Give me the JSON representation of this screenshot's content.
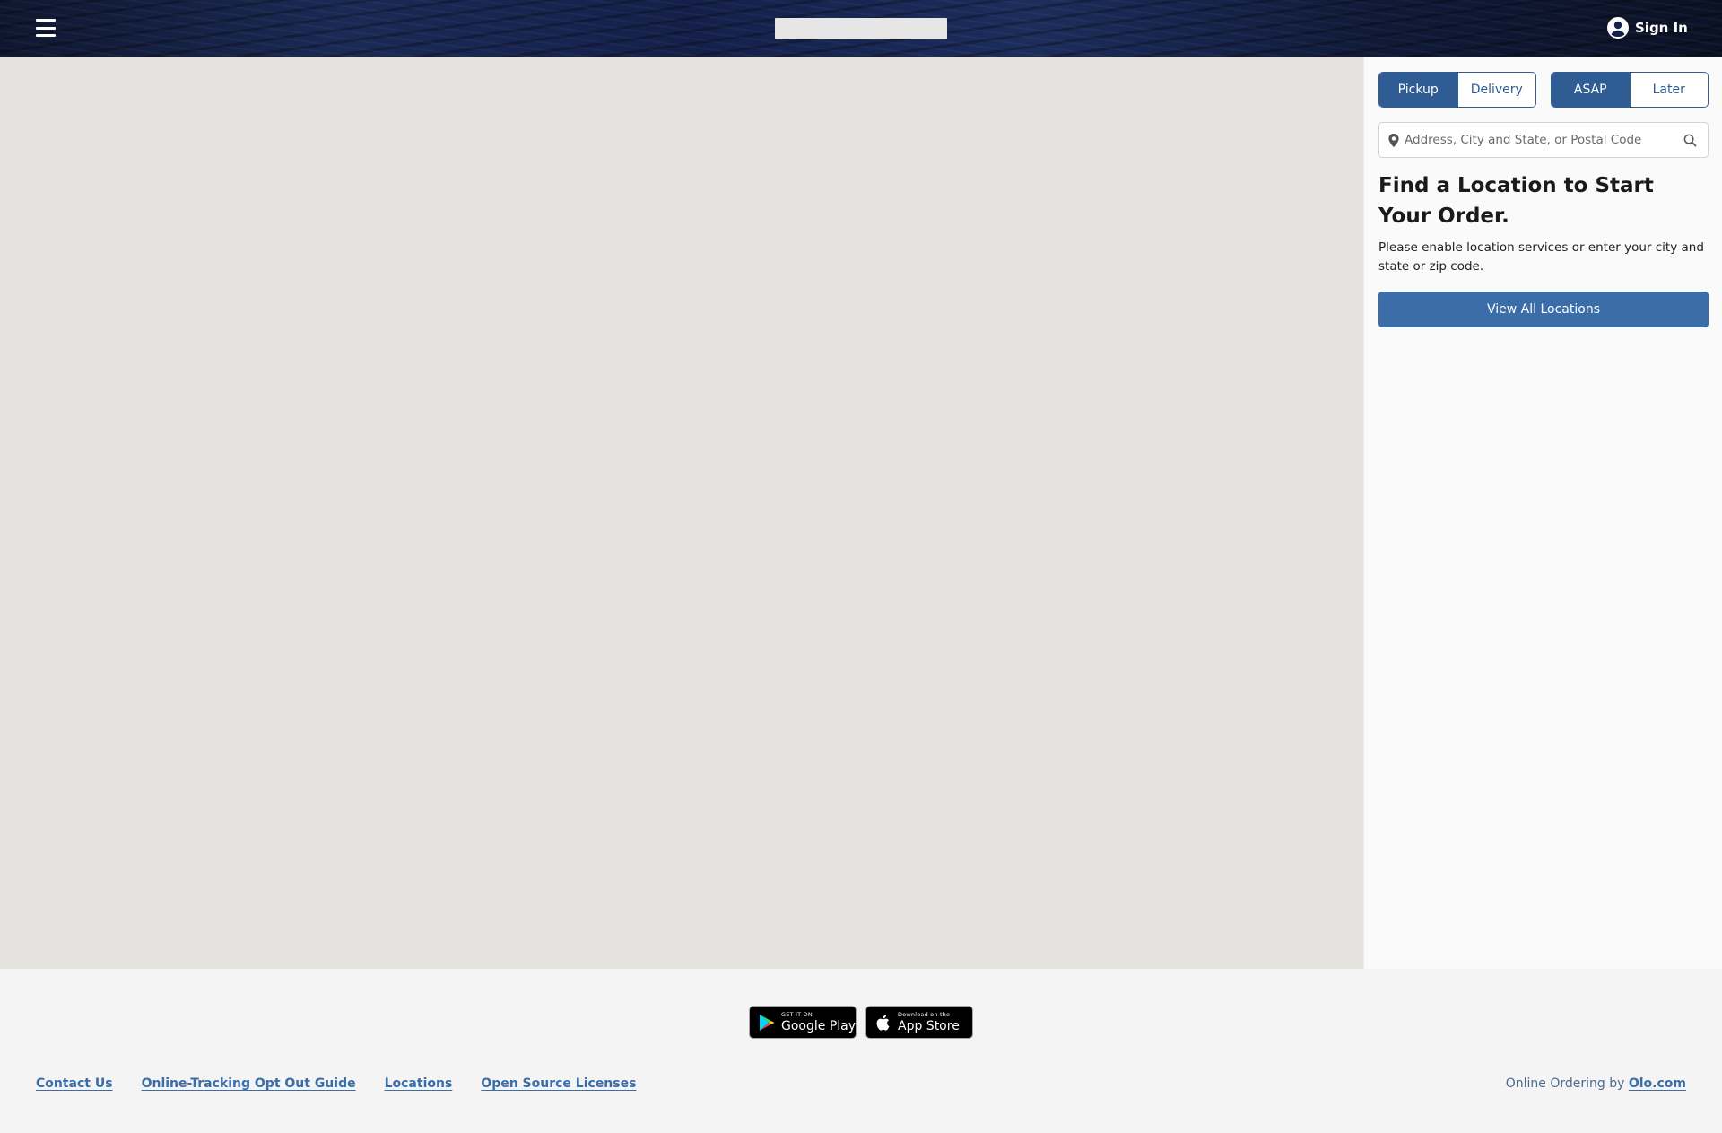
{
  "header": {
    "menu_icon": "hamburger-icon",
    "signin_label": "Sign In",
    "user_icon": "user-circle-icon"
  },
  "panel": {
    "handoff": {
      "options": [
        "Pickup",
        "Delivery"
      ],
      "selected": "Pickup"
    },
    "timing": {
      "options": [
        "ASAP",
        "Later"
      ],
      "selected": "ASAP"
    },
    "search": {
      "placeholder": "Address, City and State, or Postal Code",
      "value": "",
      "left_icon": "map-pin-icon",
      "right_icon": "search-icon"
    },
    "heading": "Find a Location to Start Your Order.",
    "subtext": "Please enable location services or enter your city and state or zip code.",
    "view_all_label": "View All Locations"
  },
  "footer": {
    "badges": {
      "google_play": {
        "small": "GET IT ON",
        "big": "Google Play"
      },
      "app_store": {
        "small": "Download on the",
        "big": "App Store"
      }
    },
    "links": [
      "Contact Us",
      "Online-Tracking Opt Out Guide",
      "Locations",
      "Open Source Licenses"
    ],
    "credit_prefix": "Online Ordering by",
    "credit_link": "Olo.com"
  },
  "colors": {
    "primary": "#2e5c93",
    "button": "#3b6ea9",
    "map_bg": "#e5e3df",
    "header_bg": "#14204a"
  }
}
